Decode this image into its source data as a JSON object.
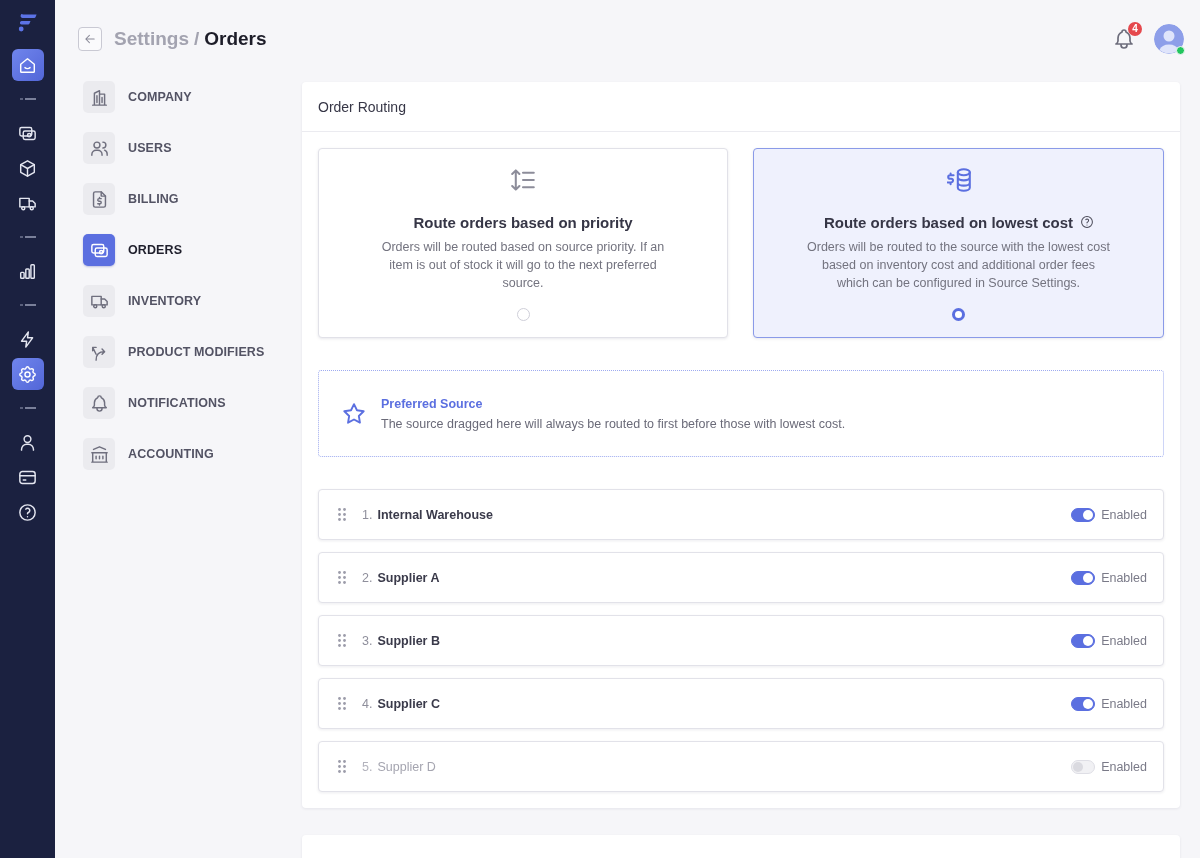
{
  "nav_rail": {
    "groups": [
      [
        {
          "selected": true
        }
      ],
      [
        {
          "selected": false
        },
        {
          "selected": false
        },
        {
          "selected": false
        }
      ],
      [
        {
          "selected": false
        }
      ],
      [
        {
          "selected": false
        },
        {
          "selected": true
        }
      ],
      [
        {
          "selected": false
        },
        {
          "selected": false
        },
        {
          "selected": false
        }
      ]
    ]
  },
  "header": {
    "breadcrumb_parent": "Settings",
    "breadcrumb_separator": "/",
    "title": "Orders",
    "notification_count": "4",
    "user_online": true
  },
  "settings_menu": {
    "items": [
      {
        "label": "COMPANY",
        "selected": false
      },
      {
        "label": "USERS",
        "selected": false
      },
      {
        "label": "BILLING",
        "selected": false
      },
      {
        "label": "ORDERS",
        "selected": true
      },
      {
        "label": "INVENTORY",
        "selected": false
      },
      {
        "label": "PRODUCT MODIFIERS",
        "selected": false
      },
      {
        "label": "NOTIFICATIONS",
        "selected": false
      },
      {
        "label": "ACCOUNTING",
        "selected": false
      }
    ]
  },
  "order_routing": {
    "title": "Order Routing",
    "options": [
      {
        "title": "Route orders based on priority",
        "description": "Orders will be routed based on source priority. If an\nitem is out of stock it will go to the next preferred\nsource.",
        "help": false,
        "selected": false
      },
      {
        "title": "Route orders based on lowest cost",
        "description": "Orders will be routed to the source with the lowest cost\nbased on inventory cost and additional order fees\nwhich can be configured in Source Settings.",
        "help": true,
        "selected": true
      }
    ],
    "preferred_source": {
      "title": "Preferred Source",
      "description": "The source dragged here will always be routed to first before those with lowest cost."
    },
    "sources": [
      {
        "number": "1.",
        "name": "Internal Warehouse",
        "enabled": true,
        "status": "Enabled"
      },
      {
        "number": "2.",
        "name": "Supplier A",
        "enabled": true,
        "status": "Enabled"
      },
      {
        "number": "3.",
        "name": "Supplier B",
        "enabled": true,
        "status": "Enabled"
      },
      {
        "number": "4.",
        "name": "Supplier C",
        "enabled": true,
        "status": "Enabled"
      },
      {
        "number": "5.",
        "name": "Supplier D",
        "enabled": false,
        "status": "Enabled"
      }
    ]
  }
}
